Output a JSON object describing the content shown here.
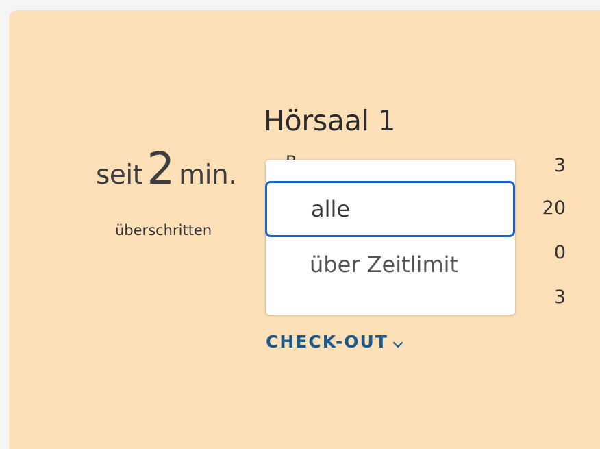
{
  "timer": {
    "prefix": "seit",
    "value": "2",
    "unit": "min.",
    "status": "überschritten"
  },
  "room": {
    "title": "Hörsaal 1",
    "hidden_row_label": "B",
    "counts": [
      "3",
      "20",
      "0",
      "3"
    ]
  },
  "dropdown": {
    "options": [
      {
        "label": "alle",
        "selected": true
      },
      {
        "label": "über Zeitlimit",
        "selected": false
      }
    ]
  },
  "actions": {
    "checkout_label": "CHECK-OUT",
    "checkout_icon": "chevron-down-icon"
  },
  "colors": {
    "card_background": "#fde0b8",
    "selection_border": "#1a63d6",
    "link_color": "#1a5a8a"
  }
}
